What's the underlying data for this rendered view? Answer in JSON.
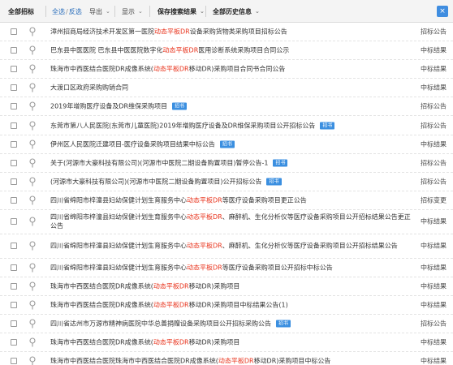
{
  "toolbar": {
    "all_label": "全部招标",
    "select_all": "全选",
    "invert": "反选",
    "sep": "/",
    "export": "导出",
    "show": "显示",
    "save_search": "保存搜索结果",
    "history": "全部历史信息",
    "close": "×"
  },
  "rows": [
    {
      "segs": [
        {
          "t": "漳州招商局经济技术开发区第一医院"
        },
        {
          "t": "动态平板DR",
          "h": true
        },
        {
          "t": "设备采购货物类采购项目招标公告"
        }
      ],
      "type": "招标公告"
    },
    {
      "segs": [
        {
          "t": "巴东县中医医院 巴东县中医医院数字化"
        },
        {
          "t": "动态平板DR",
          "h": true
        },
        {
          "t": "医用诊断系统采购项目合同公示"
        }
      ],
      "type": "中标结果"
    },
    {
      "segs": [
        {
          "t": "珠海市中西医结合医院DR成像系统("
        },
        {
          "t": "动态平板DR",
          "h": true
        },
        {
          "t": "移动DR)采购项目合同书合同公告"
        }
      ],
      "type": "中标结果"
    },
    {
      "segs": [
        {
          "t": "大渡口区政府采购购销合同"
        }
      ],
      "type": "中标结果"
    },
    {
      "segs": [
        {
          "t": "2019年增购医疗设备及DR维保采购项目"
        }
      ],
      "badge": "招书",
      "type": "招标公告"
    },
    {
      "segs": [
        {
          "t": "东莞市第八人民医院(东莞市儿童医院)2019年增购医疗设备及DR维保采购项目公开招标公告"
        }
      ],
      "badge": "招书",
      "type": "招标公告"
    },
    {
      "segs": [
        {
          "t": "伊州区人民医院迁建项目-医疗设备采购项目结果中标公告"
        }
      ],
      "badge": "招书",
      "type": "中标结果"
    },
    {
      "segs": [
        {
          "t": "关于(河源市大豪科技有限公司)(河源市中医院二期设备购置项目)暂停公告-1"
        }
      ],
      "badge": "招书",
      "type": "招标公告"
    },
    {
      "segs": [
        {
          "t": "(河源市大豪科技有限公司)(河源市中医院二期设备购置项目)公开招标公告"
        }
      ],
      "badge": "招书",
      "type": "招标公告"
    },
    {
      "segs": [
        {
          "t": "四川省绵阳市梓潼县妇幼保健计划生育服务中心"
        },
        {
          "t": "动态平板DR",
          "h": true
        },
        {
          "t": "等医疗设备采购项目更正公告"
        }
      ],
      "type": "招标变更"
    },
    {
      "tall": true,
      "segs": [
        {
          "t": "四川省绵阳市梓潼县妇幼保健计划生育服务中心"
        },
        {
          "t": "动态平板DR",
          "h": true
        },
        {
          "t": "、麻醉机、生化分析仪等医疗设备采购项目公开招标结果公告更正公告"
        }
      ],
      "type": "中标结果"
    },
    {
      "tall": true,
      "segs": [
        {
          "t": "四川省绵阳市梓潼县妇幼保健计划生育服务中心"
        },
        {
          "t": "动态平板DR",
          "h": true
        },
        {
          "t": "、麻醉机、生化分析仪等医疗设备采购项目公开招标结果公告"
        }
      ],
      "type": "中标结果"
    },
    {
      "segs": [
        {
          "t": "四川省绵阳市梓潼县妇幼保健计划生育服务中心"
        },
        {
          "t": "动态平板DR",
          "h": true
        },
        {
          "t": "等医疗设备采购项目公开招标中标公告"
        }
      ],
      "type": "中标结果"
    },
    {
      "segs": [
        {
          "t": "珠海市中西医结合医院DR成像系统("
        },
        {
          "t": "动态平板DR",
          "h": true
        },
        {
          "t": "移动DR)采购项目"
        }
      ],
      "type": "中标结果"
    },
    {
      "segs": [
        {
          "t": "珠海市中西医结合医院DR成像系统("
        },
        {
          "t": "动态平板DR",
          "h": true
        },
        {
          "t": "移动DR)采购项目中标结果公告(1)"
        }
      ],
      "type": "中标结果"
    },
    {
      "segs": [
        {
          "t": "四川省达州市万源市精神病医院中华总善捐赠设备采购项目公开招标采购公告"
        }
      ],
      "badge": "招书",
      "type": "招标公告"
    },
    {
      "segs": [
        {
          "t": "珠海市中西医结合医院DR成像系统("
        },
        {
          "t": "动态平板DR",
          "h": true
        },
        {
          "t": "移动DR)采购项目"
        }
      ],
      "type": "中标结果"
    },
    {
      "segs": [
        {
          "t": "珠海市中西医结合医院珠海市中西医结合医院DR成像系统("
        },
        {
          "t": "动态平板DR",
          "h": true
        },
        {
          "t": "移动DR)采购项目中标公告"
        }
      ],
      "type": "中标结果"
    }
  ]
}
